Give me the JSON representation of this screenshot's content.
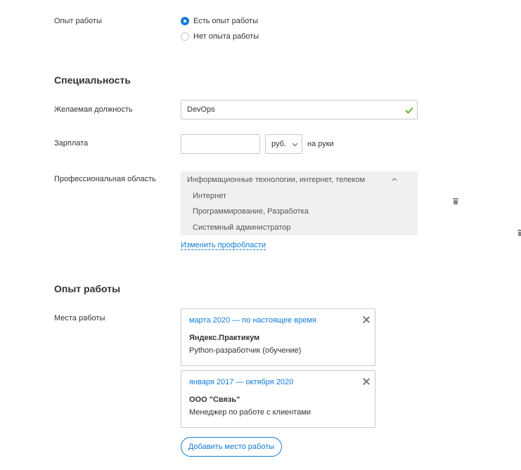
{
  "experience_choice": {
    "label": "Опыт работы",
    "options": [
      {
        "label": "Есть опыт работы",
        "checked": true
      },
      {
        "label": "Нет опыта работы",
        "checked": false
      }
    ]
  },
  "specialty": {
    "heading": "Специальность",
    "position_label": "Желаемая должность",
    "position_value": "DevOps",
    "salary_label": "Зарплата",
    "salary_value": "",
    "currency_value": "руб.",
    "salary_suffix": "на руки",
    "area_label": "Профессиональная область",
    "area_group": "Информационные технологии, интернет, телеком",
    "area_items": [
      "Интернет",
      "Программирование, Разработка",
      "Системный администратор"
    ],
    "change_link": "Изменить профобласти"
  },
  "work": {
    "heading": "Опыт работы",
    "places_label": "Места работы",
    "jobs": [
      {
        "period": "марта 2020 — по настоящее время",
        "company": "Яндекс.Практикум",
        "role": "Python-разработчик (обучение)"
      },
      {
        "period": "января 2017 — октября 2020",
        "company": "ООО \"Связь\"",
        "role": "Менеджер по работе с клиентами"
      }
    ],
    "add_button": "Добавить место работы"
  },
  "colors": {
    "accent": "#0f7ad9",
    "check": "#5cb531",
    "area_bg": "#eef0f2",
    "border": "#c9c9c9"
  }
}
